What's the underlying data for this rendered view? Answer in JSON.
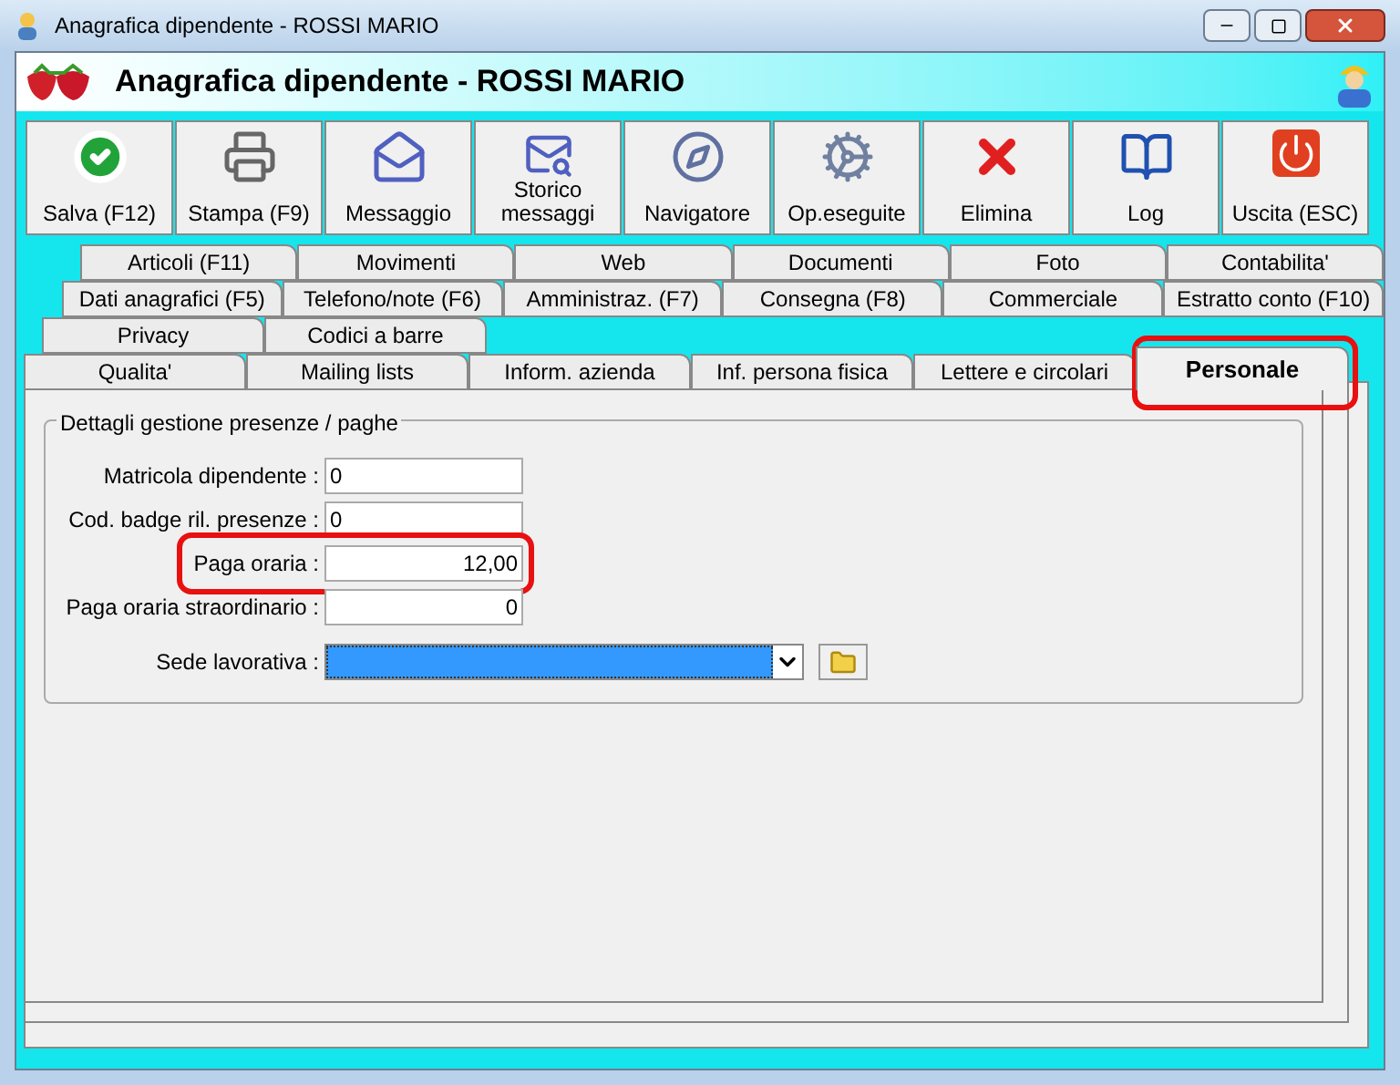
{
  "window": {
    "title": "Anagrafica dipendente - ROSSI MARIO"
  },
  "header": {
    "title": "Anagrafica dipendente - ROSSI MARIO"
  },
  "toolbar": [
    {
      "label": "Salva (F12)"
    },
    {
      "label": "Stampa (F9)"
    },
    {
      "label": "Messaggio"
    },
    {
      "label": "Storico\nmessaggi"
    },
    {
      "label": "Navigatore"
    },
    {
      "label": "Op.eseguite"
    },
    {
      "label": "Elimina"
    },
    {
      "label": "Log"
    },
    {
      "label": "Uscita (ESC)"
    }
  ],
  "tab_rows": [
    [
      {
        "label": "Articoli (F11)",
        "selected": false
      },
      {
        "label": "Movimenti",
        "selected": false
      },
      {
        "label": "Web",
        "selected": false
      },
      {
        "label": "Documenti",
        "selected": false
      },
      {
        "label": "Foto",
        "selected": false
      },
      {
        "label": "Contabilita'",
        "selected": false
      }
    ],
    [
      {
        "label": "Dati anagrafici (F5)",
        "selected": false
      },
      {
        "label": "Telefono/note (F6)",
        "selected": false
      },
      {
        "label": "Amministraz. (F7)",
        "selected": false
      },
      {
        "label": "Consegna (F8)",
        "selected": false
      },
      {
        "label": "Commerciale",
        "selected": false
      },
      {
        "label": "Estratto conto (F10)",
        "selected": false
      }
    ],
    [
      {
        "label": "Privacy",
        "selected": false
      },
      {
        "label": "Codici a barre",
        "selected": false
      }
    ],
    [
      {
        "label": "Qualita'",
        "selected": false
      },
      {
        "label": "Mailing lists",
        "selected": false
      },
      {
        "label": "Inform. azienda",
        "selected": false
      },
      {
        "label": "Inf. persona fisica",
        "selected": false
      },
      {
        "label": "Lettere e circolari",
        "selected": false
      },
      {
        "label": "Personale",
        "selected": true
      }
    ]
  ],
  "group": {
    "title": "Dettagli gestione presenze / paghe",
    "fields": [
      {
        "kind": "text",
        "label": "Matricola dipendente :",
        "value": "0",
        "highlighted": false
      },
      {
        "kind": "text",
        "label": "Cod. badge ril. presenze :",
        "value": "0",
        "highlighted": false
      },
      {
        "kind": "number",
        "label": "Paga oraria :",
        "value": "12,00",
        "highlighted": true
      },
      {
        "kind": "number",
        "label": "Paga oraria straordinario :",
        "value": "0",
        "highlighted": false
      },
      {
        "kind": "combo",
        "label": "Sede lavorativa :",
        "highlighted": false
      }
    ]
  }
}
